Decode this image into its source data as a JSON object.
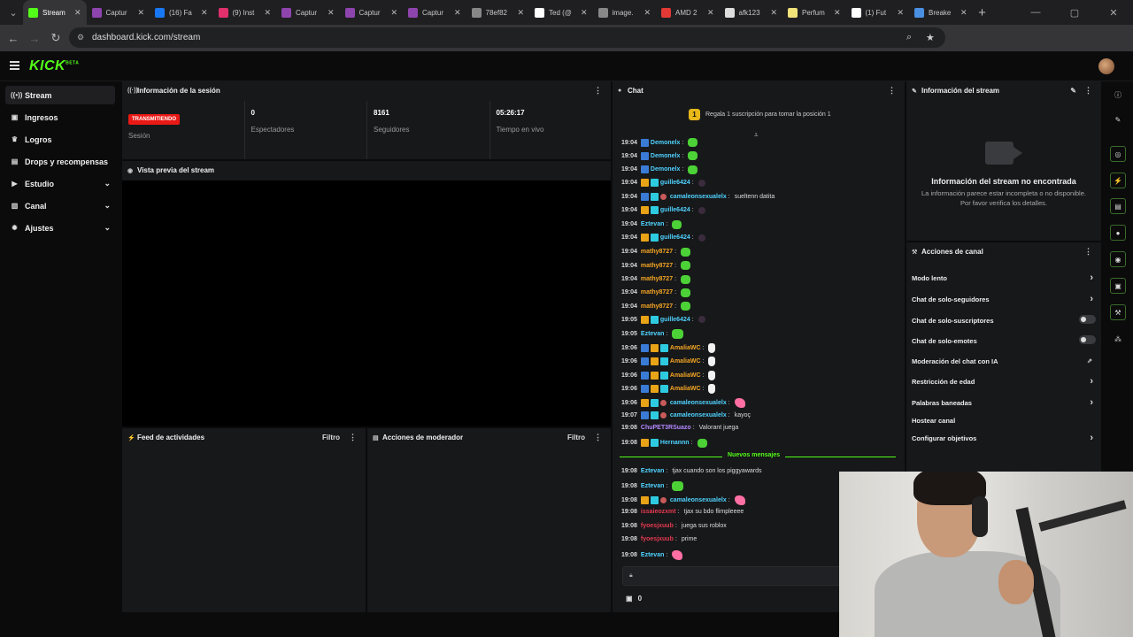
{
  "browser": {
    "tabs": [
      {
        "label": "Stream",
        "color": "#53fc18",
        "active": true
      },
      {
        "label": "Captur",
        "color": "#8e44ad"
      },
      {
        "label": "(16) Fa",
        "color": "#1877f2"
      },
      {
        "label": "(9) Inst",
        "color": "#e1306c"
      },
      {
        "label": "Captur",
        "color": "#8e44ad"
      },
      {
        "label": "Captur",
        "color": "#8e44ad"
      },
      {
        "label": "Captur",
        "color": "#8e44ad"
      },
      {
        "label": "78ef82",
        "color": "#888888"
      },
      {
        "label": "Ted (@",
        "color": "#ffffff"
      },
      {
        "label": "image.",
        "color": "#888888"
      },
      {
        "label": "AMD 2",
        "color": "#e53935"
      },
      {
        "label": "afk123",
        "color": "#dddddd"
      },
      {
        "label": "Perfum",
        "color": "#f1e27a"
      },
      {
        "label": "(1) Fut",
        "color": "#ffffff"
      },
      {
        "label": "Breake",
        "color": "#4a90e2"
      }
    ],
    "url": "dashboard.kick.com/stream"
  },
  "app": {
    "logo": "KICK",
    "logo_beta": "BETA"
  },
  "sidebar": {
    "items": [
      {
        "label": "Stream",
        "icon": "broadcast-icon"
      },
      {
        "label": "Ingresos",
        "icon": "wallet-icon"
      },
      {
        "label": "Logros",
        "icon": "trophy-icon"
      },
      {
        "label": "Drops y recompensas",
        "icon": "gift-icon"
      },
      {
        "label": "Estudio",
        "icon": "video-icon"
      },
      {
        "label": "Canal",
        "icon": "channel-icon"
      },
      {
        "label": "Ajustes",
        "icon": "gear-icon"
      }
    ]
  },
  "session": {
    "title": "Información de la sesión",
    "status": "TRANSMITIENDO",
    "status_label": "Sesión",
    "viewers": "0",
    "viewers_label": "Espectadores",
    "followers": "8161",
    "followers_label": "Seguidores",
    "live_time": "05:26:17",
    "live_time_label": "Tiempo en vivo"
  },
  "preview": {
    "title": "Vista previa del stream"
  },
  "activity": {
    "title": "Feed de actividades",
    "filter": "Filtro"
  },
  "moderator": {
    "title": "Acciones de moderador",
    "filter": "Filtro"
  },
  "chat": {
    "title": "Chat",
    "pinned": "Regala 1 suscripción para tomar la posición 1",
    "pinned_rank": "1",
    "new_messages": "Nuevos mensajes",
    "footer_count": "0",
    "messages": [
      {
        "time": "19:04",
        "user": "Demonelx",
        "color": "#4fd3ff",
        "text": "",
        "badges": [
          "blue"
        ],
        "emote": "green"
      },
      {
        "time": "19:04",
        "user": "Demonelx",
        "color": "#4fd3ff",
        "text": "",
        "badges": [
          "blue"
        ],
        "emote": "green"
      },
      {
        "time": "19:04",
        "user": "Demonelx",
        "color": "#4fd3ff",
        "text": "",
        "badges": [
          "blue"
        ],
        "emote": "green"
      },
      {
        "time": "19:04",
        "user": "guille6424",
        "color": "#4fd3ff",
        "text": "",
        "badges": [
          "gold",
          "cyan"
        ],
        "emote": "dark"
      },
      {
        "time": "19:04",
        "user": "camaleonsexualelx",
        "color": "#4fd3ff",
        "text": "sueltenn datita",
        "badges": [
          "blue",
          "cyan"
        ],
        "avatar": true
      },
      {
        "time": "19:04",
        "user": "guille6424",
        "color": "#4fd3ff",
        "text": "",
        "badges": [
          "gold",
          "cyan"
        ],
        "emote": "dark"
      },
      {
        "time": "19:04",
        "user": "Eztevan",
        "color": "#4fd3ff",
        "text": "",
        "badges": [],
        "emote": "green"
      },
      {
        "time": "19:04",
        "user": "guille6424",
        "color": "#4fd3ff",
        "text": "",
        "badges": [
          "gold",
          "cyan"
        ],
        "emote": "dark"
      },
      {
        "time": "19:04",
        "user": "mathy8727",
        "color": "#f5a623",
        "text": "",
        "badges": [],
        "emote": "green"
      },
      {
        "time": "19:04",
        "user": "mathy8727",
        "color": "#f5a623",
        "text": "",
        "badges": [],
        "emote": "green"
      },
      {
        "time": "19:04",
        "user": "mathy8727",
        "color": "#f5a623",
        "text": "",
        "badges": [],
        "emote": "green"
      },
      {
        "time": "19:04",
        "user": "mathy8727",
        "color": "#f5a623",
        "text": "",
        "badges": [],
        "emote": "green"
      },
      {
        "time": "19:04",
        "user": "mathy8727",
        "color": "#f5a623",
        "text": "",
        "badges": [],
        "emote": "green"
      },
      {
        "time": "19:05",
        "user": "guille6424",
        "color": "#4fd3ff",
        "text": "",
        "badges": [
          "gold",
          "cyan"
        ],
        "emote": "dark"
      },
      {
        "time": "19:05",
        "user": "Eztevan",
        "color": "#4fd3ff",
        "text": "",
        "badges": [],
        "emote": "green-big"
      },
      {
        "time": "19:06",
        "user": "AmaliaWC",
        "color": "#f5a623",
        "text": "",
        "badges": [
          "blue",
          "gold",
          "cyan"
        ],
        "emote": "hand"
      },
      {
        "time": "19:06",
        "user": "AmaliaWC",
        "color": "#f5a623",
        "text": "",
        "badges": [
          "blue",
          "gold",
          "cyan"
        ],
        "emote": "hand"
      },
      {
        "time": "19:06",
        "user": "AmaliaWC",
        "color": "#f5a623",
        "text": "",
        "badges": [
          "blue",
          "gold",
          "cyan"
        ],
        "emote": "hand"
      },
      {
        "time": "19:06",
        "user": "AmaliaWC",
        "color": "#f5a623",
        "text": "",
        "badges": [
          "blue",
          "gold",
          "cyan"
        ],
        "emote": "hand"
      },
      {
        "time": "19:06",
        "user": "camaleonsexualelx",
        "color": "#4fd3ff",
        "text": "",
        "badges": [
          "gold",
          "cyan"
        ],
        "avatar": true,
        "emote": "pink"
      },
      {
        "time": "19:07",
        "user": "camaleonsexualelx",
        "color": "#4fd3ff",
        "text": "kayoç",
        "badges": [
          "blue",
          "cyan"
        ],
        "avatar": true
      },
      {
        "time": "19:08",
        "user": "ChuPET3RSuazo",
        "color": "#b388ff",
        "text": "Valorant juega",
        "badges": []
      },
      {
        "time": "19:08",
        "user": "Hernannn",
        "color": "#4fd3ff",
        "text": "",
        "badges": [
          "gold",
          "cyan"
        ],
        "emote": "green"
      },
      {
        "time": "19:08",
        "user": "Eztevan",
        "color": "#4fd3ff",
        "text": "tjax cuando son los piggyawards",
        "badges": []
      },
      {
        "time": "19:08",
        "user": "Eztevan",
        "color": "#4fd3ff",
        "text": "",
        "badges": [],
        "emote": "green-big"
      },
      {
        "time": "19:08",
        "user": "camaleonsexualelx",
        "color": "#4fd3ff",
        "text": "",
        "badges": [
          "gold",
          "cyan"
        ],
        "avatar": true,
        "emote": "pink"
      },
      {
        "time": "19:08",
        "user": "issaieozxmt",
        "color": "#e53950",
        "text": "tjax su bdo flimpleeee",
        "badges": []
      },
      {
        "time": "19:08",
        "user": "fyoesjxuub",
        "color": "#e53950",
        "text": "juega sus roblox",
        "badges": []
      },
      {
        "time": "19:08",
        "user": "fyoesjxuub",
        "color": "#e53950",
        "text": "prime",
        "badges": []
      },
      {
        "time": "19:08",
        "user": "Eztevan",
        "color": "#4fd3ff",
        "text": "",
        "badges": [],
        "emote": "pink"
      }
    ]
  },
  "stream_info": {
    "title": "Información del stream",
    "not_found_title": "Información del stream no encontrada",
    "not_found_line1": "La información parece estar incompleta o no disponible.",
    "not_found_line2": "Por favor verifica los detalles."
  },
  "channel_actions": {
    "title": "Acciones de canal",
    "items": [
      {
        "label": "Modo lento",
        "kind": "arrow"
      },
      {
        "label": "Chat de solo-seguidores",
        "kind": "arrow"
      },
      {
        "label": "Chat de solo-suscriptores",
        "kind": "toggle"
      },
      {
        "label": "Chat de solo-emotes",
        "kind": "toggle"
      },
      {
        "label": "Moderación del chat con IA",
        "kind": "external"
      },
      {
        "label": "Restricción de edad",
        "kind": "arrow"
      },
      {
        "label": "Palabras baneadas",
        "kind": "arrow"
      },
      {
        "label": "Hostear canal",
        "kind": "none"
      },
      {
        "label": "Configurar objetivos",
        "kind": "arrow"
      }
    ]
  },
  "colors": {
    "brand": "#53fc18",
    "live": "#e91916",
    "panel": "#17181a"
  }
}
